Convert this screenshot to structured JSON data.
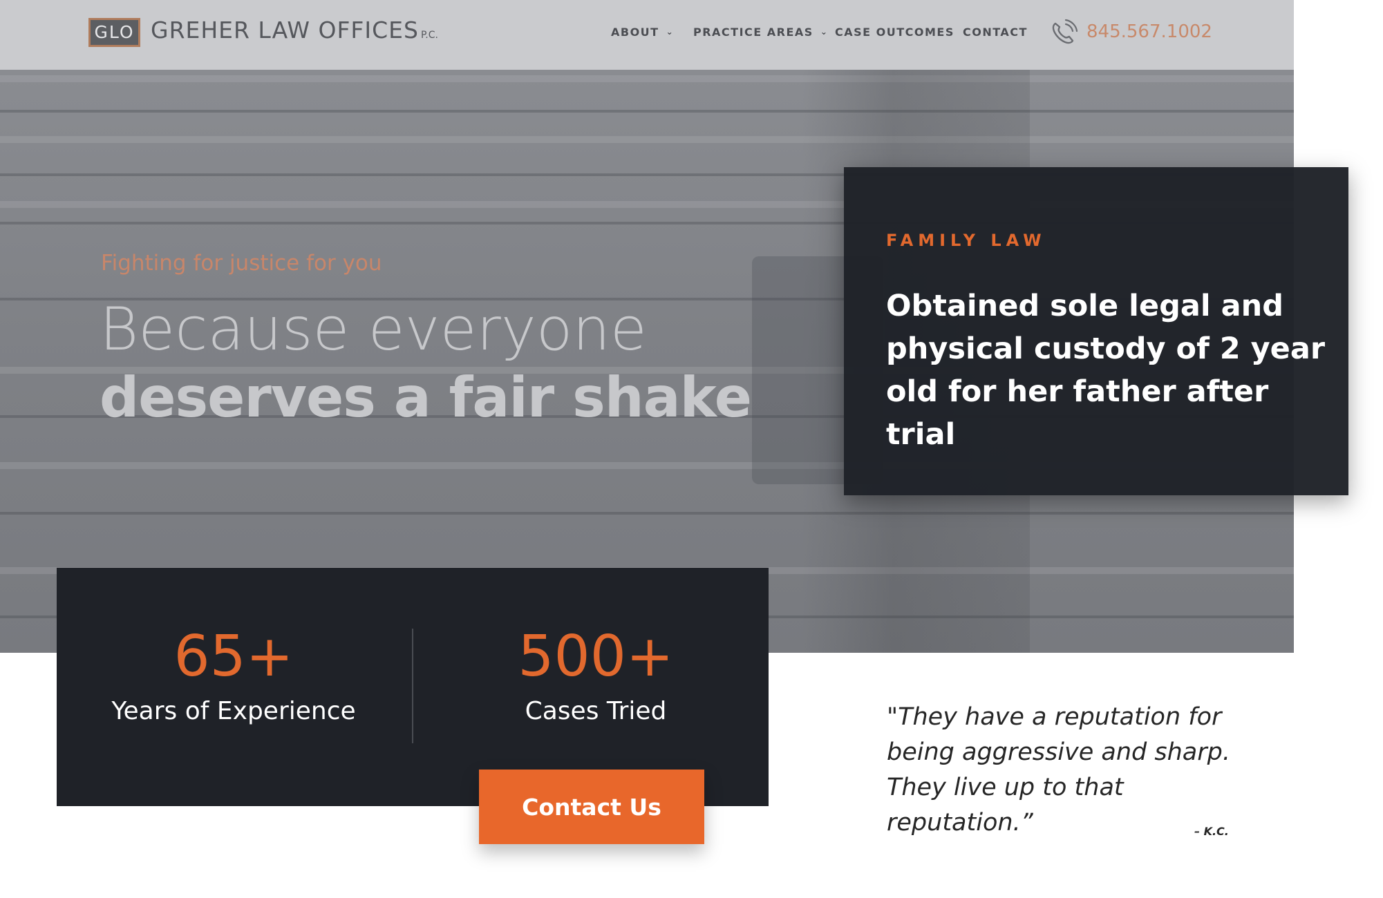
{
  "header": {
    "logo_mark": "GLO",
    "firm_name": "GREHER LAW OFFICES",
    "firm_suffix": "P.C.",
    "nav": [
      {
        "label": "ABOUT",
        "has_dropdown": true
      },
      {
        "label": "PRACTICE AREAS",
        "has_dropdown": true
      },
      {
        "label": "CASE OUTCOMES",
        "has_dropdown": false
      },
      {
        "label": "CONTACT",
        "has_dropdown": false
      }
    ],
    "phone_icon": "phone-icon",
    "phone": "845.567.1002"
  },
  "hero": {
    "tagline": "Fighting for justice for you",
    "headline_line1": "Because everyone",
    "headline_line2": "deserves a fair shake"
  },
  "case_card": {
    "category": "FAMILY LAW",
    "text": "Obtained sole legal and physical custody of 2 year old for her father after trial"
  },
  "stats": [
    {
      "value": "65+",
      "label": "Years of Experience"
    },
    {
      "value": "500+",
      "label": "Cases Tried"
    }
  ],
  "cta": {
    "label": "Contact Us"
  },
  "testimonial": {
    "quote": "\"They have a reputation for being aggressive and sharp. They live up to that reputation.”",
    "author": "– K.C."
  },
  "colors": {
    "accent": "#e8672b",
    "dark_panel": "#1f2228",
    "header_bg": "#cacbce",
    "phone_text": "#c8896a"
  }
}
